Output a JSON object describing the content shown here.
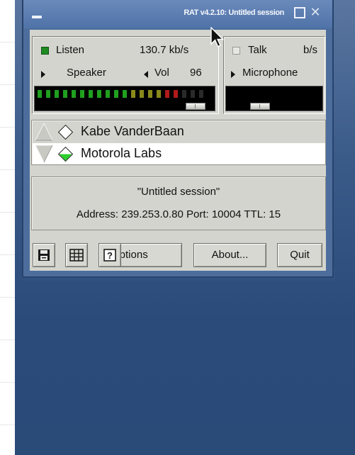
{
  "window": {
    "title": "RAT v4.2.10: Untitled session",
    "menu_icon": "window-menu-icon",
    "maximize_icon": "maximize-icon",
    "close_icon": "close-icon"
  },
  "receive": {
    "listen_label": "Listen",
    "listen_led": "on",
    "bitrate": "130.7 kb/s",
    "device_label": "Speaker",
    "volume_label": "Vol",
    "volume_value": "96",
    "level_segments": 20,
    "level_lit": 17
  },
  "transmit": {
    "talk_label": "Talk",
    "talk_led": "off",
    "bitrate_unit": "b/s",
    "device_label": "Microphone"
  },
  "participants": [
    {
      "name": "Kabe VanderBaan",
      "status_color": "#ffffff",
      "selected": false
    },
    {
      "name": "Motorola Labs",
      "status_color": "#2bd12b",
      "selected": true
    }
  ],
  "session": {
    "title": "\"Untitled session\"",
    "address_line": "Address: 239.253.0.80 Port: 10004 TTL: 15"
  },
  "toolbar": {
    "save_icon": "floppy-disk-icon",
    "grid_icon": "grid-icon",
    "help_icon": "help-icon",
    "help_glyph": "?",
    "options_label": "Options",
    "about_label": "About...",
    "quit_label": "Quit"
  },
  "colors": {
    "led_on": "#1f8a22",
    "meter_green": "#1fa01f",
    "meter_olive": "#8a8a1a",
    "meter_red": "#b01a1a",
    "desktop": "#2b4c7b"
  }
}
